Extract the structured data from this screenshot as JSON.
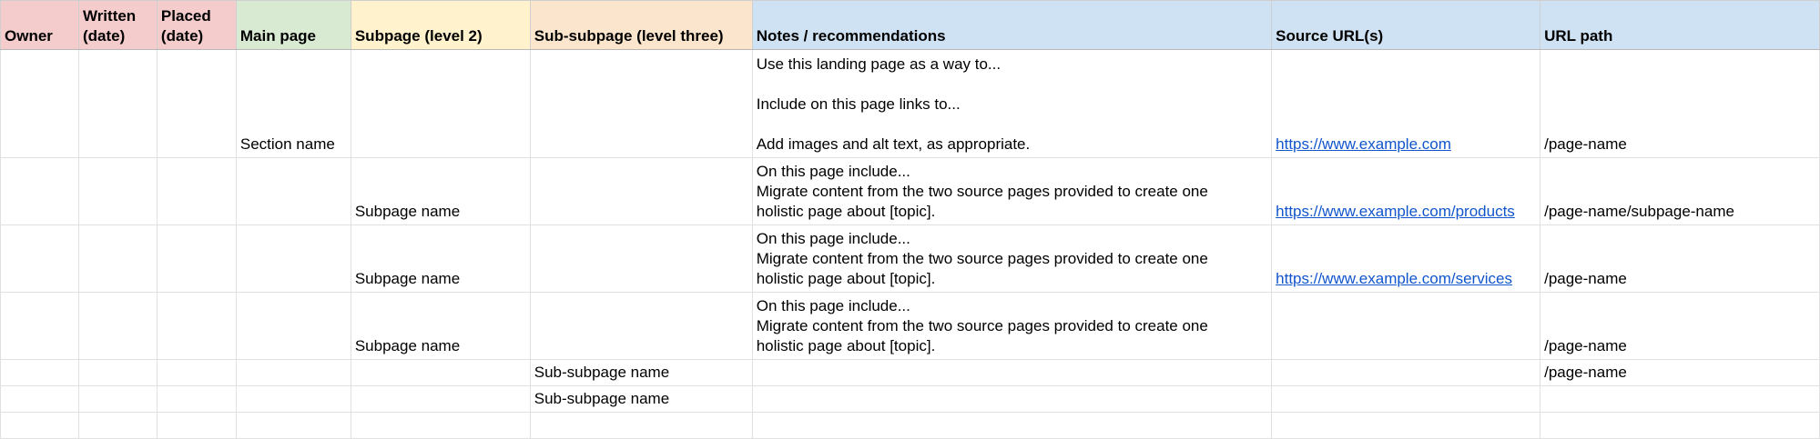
{
  "columns": [
    {
      "id": "owner",
      "lines": [
        "Owner"
      ]
    },
    {
      "id": "written",
      "lines": [
        "Written",
        "(date)"
      ]
    },
    {
      "id": "placed",
      "lines": [
        "Placed",
        "(date)"
      ]
    },
    {
      "id": "main",
      "lines": [
        "Main page"
      ]
    },
    {
      "id": "sub",
      "lines": [
        "Subpage (level 2)"
      ]
    },
    {
      "id": "subsub",
      "lines": [
        "Sub-subpage (level three)"
      ]
    },
    {
      "id": "notes",
      "lines": [
        "Notes / recommendations"
      ]
    },
    {
      "id": "src",
      "lines": [
        "Source URL(s)"
      ]
    },
    {
      "id": "path",
      "lines": [
        "URL path"
      ]
    }
  ],
  "rows": [
    {
      "main": "Section name",
      "sub": "",
      "subsub": "",
      "notes": [
        "Use this landing page as a way to...",
        "",
        "Include on this page links to...",
        "",
        "Add images and alt text, as appropriate."
      ],
      "src": "https://www.example.com",
      "path": "/page-name"
    },
    {
      "main": "",
      "sub": "Subpage name",
      "subsub": "",
      "notes": [
        "On this page include...",
        "Migrate content from the two source pages provided to create one",
        "holistic page about [topic]."
      ],
      "src": "https://www.example.com/products",
      "path": "/page-name/subpage-name"
    },
    {
      "main": "",
      "sub": "Subpage name",
      "subsub": "",
      "notes": [
        "On this page include...",
        "Migrate content from the two source pages provided to create one",
        "holistic page about [topic]."
      ],
      "src": "https://www.example.com/services",
      "path": "/page-name"
    },
    {
      "main": "",
      "sub": "Subpage name",
      "subsub": "",
      "notes": [
        "On this page include...",
        "Migrate content from the two source pages provided to create one",
        "holistic page about [topic]."
      ],
      "src": "",
      "path": "/page-name"
    },
    {
      "main": "",
      "sub": "",
      "subsub": "Sub-subpage name",
      "notes": [],
      "src": "",
      "path": "/page-name"
    },
    {
      "main": "",
      "sub": "",
      "subsub": "Sub-subpage name",
      "notes": [],
      "src": "",
      "path": ""
    },
    {
      "main": "",
      "sub": "",
      "subsub": "",
      "notes": [],
      "src": "",
      "path": ""
    }
  ],
  "colors": {
    "header_red": "#f4cccc",
    "header_green": "#d9ead3",
    "header_yellow": "#fff2cc",
    "header_orange": "#fce5cd",
    "header_blue": "#cfe2f3",
    "link": "#1155cc"
  }
}
